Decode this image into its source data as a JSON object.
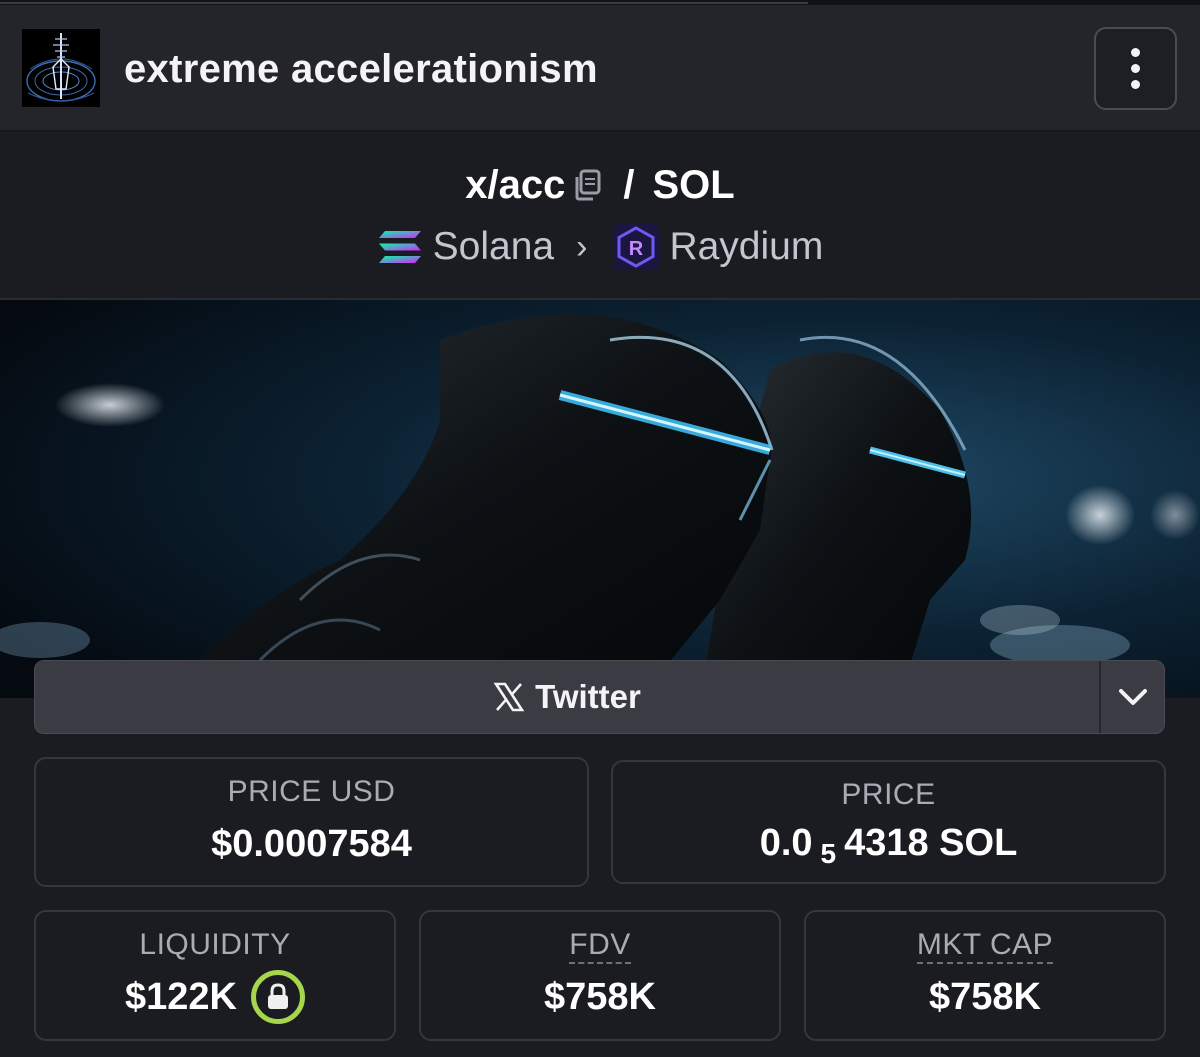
{
  "header": {
    "token_name": "extreme accelerationism",
    "avatar_icon": "token-avatar-icon",
    "menu_icon": "more-vertical-icon"
  },
  "pair": {
    "base": "x/acc",
    "separator": "/",
    "quote": "SOL",
    "copy_icon": "copy-icon"
  },
  "chain": {
    "name": "Solana",
    "icon": "solana-icon",
    "chevron": "›",
    "dex": "Raydium",
    "dex_icon": "raydium-icon"
  },
  "banner": {
    "image": "banner-image"
  },
  "social": {
    "label": "Twitter",
    "icon": "x-logo-icon",
    "toggle_icon": "chevron-down-icon"
  },
  "stats": {
    "price_usd": {
      "label": "PRICE USD",
      "value": "$0.0007584"
    },
    "price": {
      "label": "PRICE",
      "prefix": "0.0",
      "subscript": "5",
      "suffix": "4318 SOL"
    },
    "liquidity": {
      "label": "LIQUIDITY",
      "value": "$122K",
      "lock_icon": "lock-icon"
    },
    "fdv": {
      "label": "FDV",
      "value": "$758K"
    },
    "mkt_cap": {
      "label": "MKT CAP",
      "value": "$758K"
    }
  },
  "colors": {
    "background": "#1b1c22",
    "header": "#24252b",
    "card_border": "#35363e",
    "lock_accent": "#a6d64a",
    "label_gray": "#a9abb5"
  }
}
